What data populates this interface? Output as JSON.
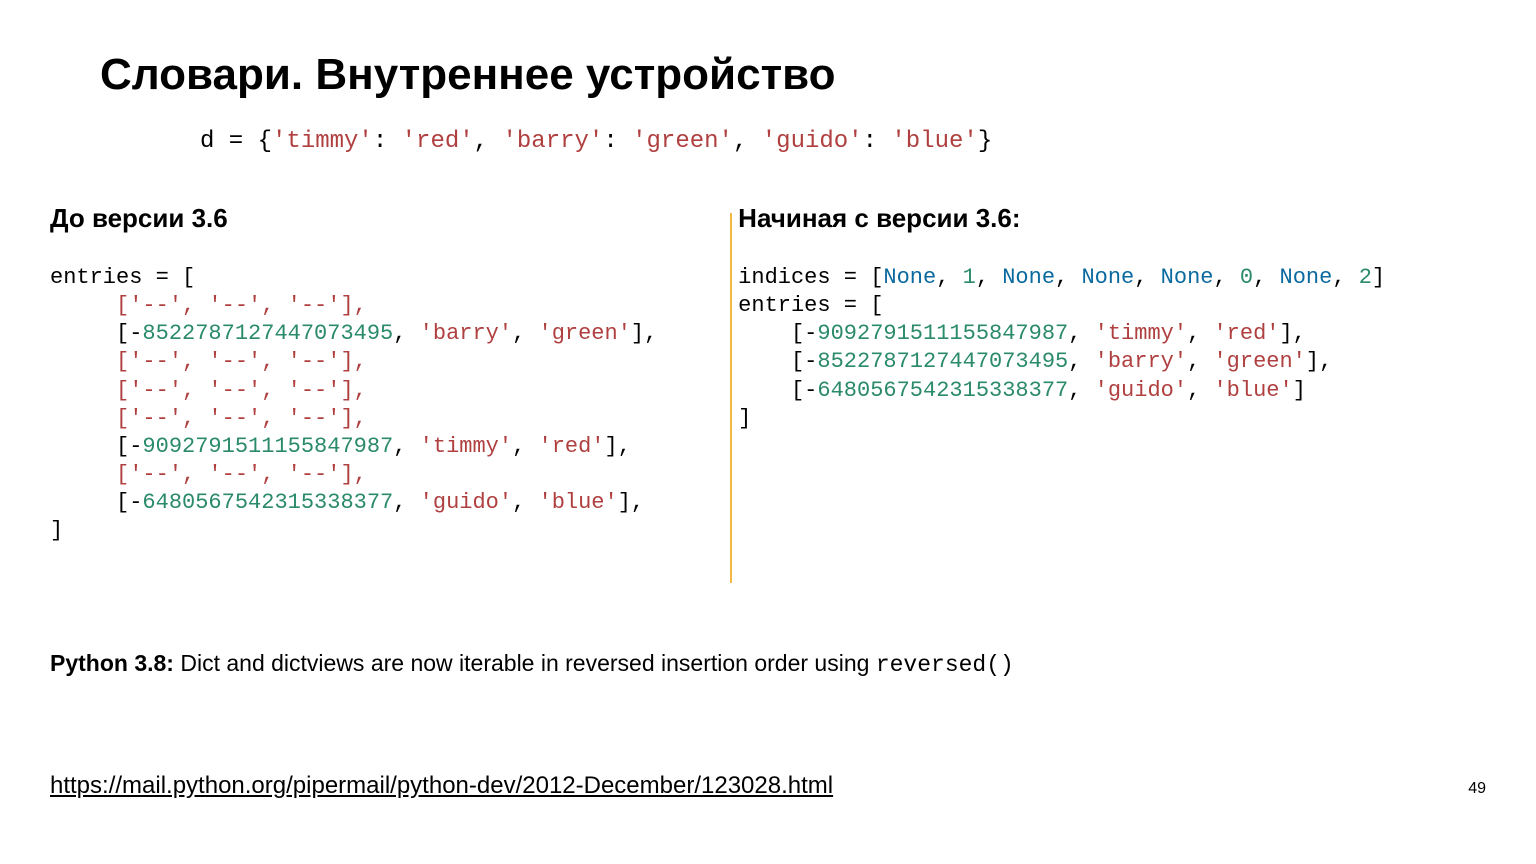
{
  "title": "Словари. Внутреннее устройство",
  "dict_example": {
    "var": "d = {",
    "k1": "'timmy'",
    "v1": "'red'",
    "k2": "'barry'",
    "v2": "'green'",
    "k3": "'guido'",
    "v3": "'blue'",
    "close": "}"
  },
  "left": {
    "heading": "До версии 3.6",
    "entries_label": "entries = [",
    "empty_row": "['--', '--', '--'],",
    "r_barry": {
      "hash": "8522787127447073495",
      "k": "'barry'",
      "v": "'green'"
    },
    "r_timmy": {
      "hash": "9092791511155847987",
      "k": "'timmy'",
      "v": "'red'"
    },
    "r_guido": {
      "hash": "6480567542315338377",
      "k": "'guido'",
      "v": "'blue'"
    },
    "close": "]"
  },
  "right": {
    "heading": "Начиная с версии 3.6:",
    "indices_label": "indices = [",
    "none_kw": "None",
    "n1": "1",
    "n0": "0",
    "n2": "2",
    "entries_label": "entries = [",
    "r0": {
      "hash": "9092791511155847987",
      "k": "'timmy'",
      "v": "'red'"
    },
    "r1": {
      "hash": "8522787127447073495",
      "k": "'barry'",
      "v": "'green'"
    },
    "r2": {
      "hash": "6480567542315338377",
      "k": "'guido'",
      "v": "'blue'"
    },
    "close": "]"
  },
  "note": {
    "label": "Python 3.8:",
    "text": "  Dict and dictviews are now iterable in reversed insertion order using ",
    "code": "reversed()"
  },
  "link": "https://mail.python.org/pipermail/python-dev/2012-December/123028.html",
  "pagenum": "49"
}
